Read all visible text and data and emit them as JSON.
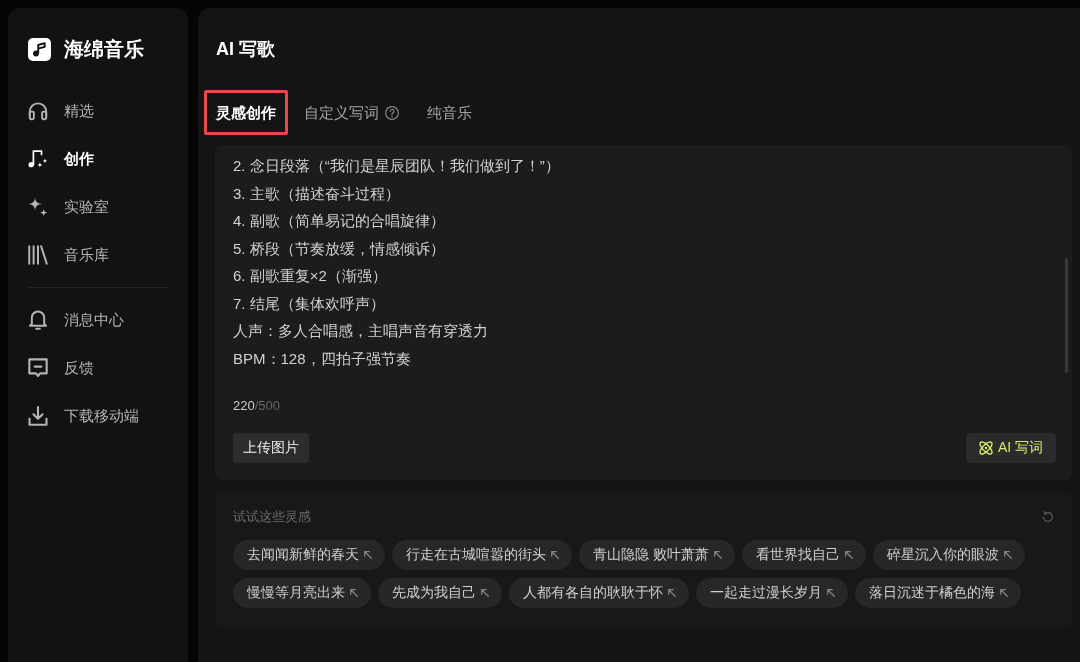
{
  "sidebar": {
    "app_name": "海绵音乐",
    "groups": [
      {
        "items": [
          {
            "label": "精选",
            "selected": false
          },
          {
            "label": "创作",
            "selected": true
          },
          {
            "label": "实验室",
            "selected": false
          },
          {
            "label": "音乐库",
            "selected": false
          }
        ]
      },
      {
        "items": [
          {
            "label": "消息中心",
            "selected": false
          },
          {
            "label": "反馈",
            "selected": false
          },
          {
            "label": "下载移动端",
            "selected": false
          }
        ]
      }
    ]
  },
  "main": {
    "title": "AI 写歌",
    "tabs": [
      {
        "label": "灵感创作",
        "selected": true,
        "highlighted": true,
        "help": false
      },
      {
        "label": "自定义写词",
        "selected": false,
        "highlighted": false,
        "help": true
      },
      {
        "label": "纯音乐",
        "selected": false,
        "highlighted": false,
        "help": false
      }
    ]
  },
  "prompt": {
    "lines": [
      "2. 念日段落（“我们是星辰团队！我们做到了！”）",
      "3. 主歌（描述奋斗过程）",
      "4. 副歌（简单易记的合唱旋律）",
      "5. 桥段（节奏放缓，情感倾诉）",
      "6. 副歌重复×2（渐强）",
      "7. 结尾（集体欢呼声）",
      "人声：多人合唱感，主唱声音有穿透力",
      "BPM：128，四拍子强节奏"
    ],
    "count": "220",
    "limit": "/500",
    "upload_button": "上传图片",
    "generate_button": "AI 写词"
  },
  "suggestions": {
    "label": "试试这些灵感",
    "chips": [
      "去闻闻新鲜的春天",
      "行走在古城喧嚣的街头",
      "青山隐隐 败叶萧萧",
      "看世界找自己",
      "碎星沉入你的眼波",
      "慢慢等月亮出来",
      "先成为我自己",
      "人都有各自的耿耿于怀",
      "一起走过漫长岁月",
      "落日沉迷于橘色的海"
    ]
  }
}
